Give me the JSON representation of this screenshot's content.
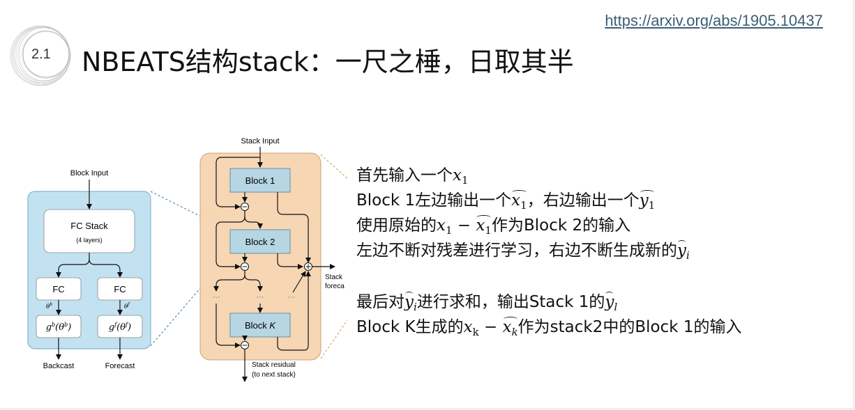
{
  "header": {
    "url": "https://arxiv.org/abs/1905.10437",
    "section_number": "2.1",
    "title": "NBEATS结构stack：一尺之棰，日取其半"
  },
  "block_diagram": {
    "input_label": "Block Input",
    "fc_stack_title": "FC Stack",
    "fc_stack_sub": "(4 layers)",
    "fc_left": "FC",
    "fc_right": "FC",
    "theta_b": "θ",
    "theta_b_sup": "b",
    "theta_f": "θ",
    "theta_f_sup": "f",
    "backcast_label": "Backcast",
    "forecast_label": "Forecast"
  },
  "stack_diagram": {
    "input_label": "Stack Input",
    "block1_label": "Block 1",
    "block2_label": "Block 2",
    "blockk_label": "Block ",
    "blockk_var": "K",
    "dots": "···",
    "minus": "−",
    "plus": "+",
    "forecast_label_line1": "Stack",
    "forecast_label_line2": "foreca",
    "residual_line1": "Stack residual",
    "residual_line2": "(to next stack)"
  },
  "description": {
    "line1_text": "首先输入一个",
    "x": "x",
    "one": "1",
    "line2_a": "Block 1左边输出一个",
    "line2_b": "，右边输出一个",
    "y": "y",
    "line3_a": "使用原始的",
    "minus": " − ",
    "line3_b": "作为Block 2的输入",
    "line4": "左边不断对残差进行学习，右边不断生成新的",
    "i": "i",
    "line5_a": "最后对",
    "line5_b": "进行求和，输出Stack 1的",
    "l": "l",
    "line6_a": "Block K生成的",
    "k_sub": "k",
    "k": "k",
    "line6_b": "作为stack2中的Block 1的输入"
  }
}
